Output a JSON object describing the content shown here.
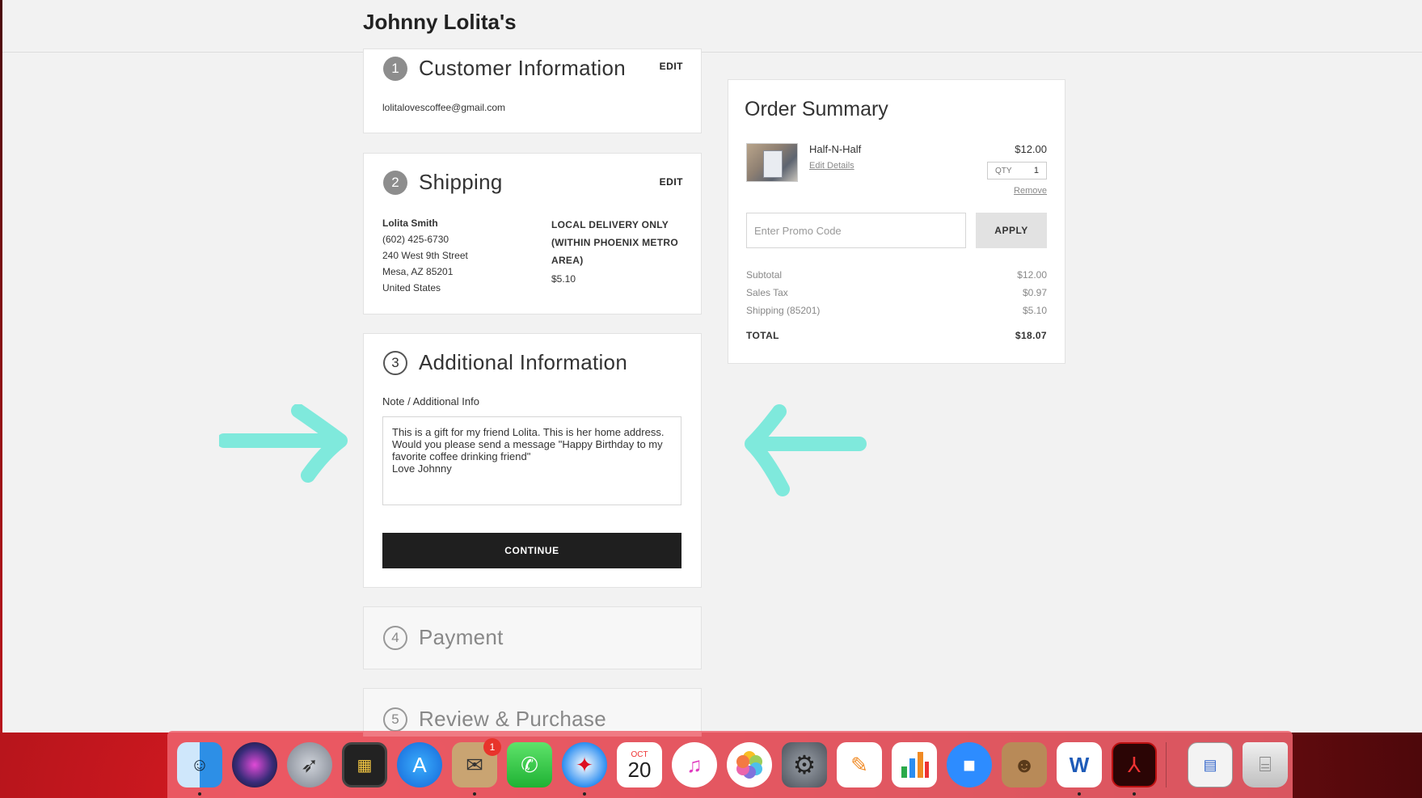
{
  "store": {
    "title": "Johnny Lolita's"
  },
  "customer": {
    "step": "1",
    "title": "Customer Information",
    "edit": "EDIT",
    "email": "lolitalovescoffee@gmail.com"
  },
  "shipping": {
    "step": "2",
    "title": "Shipping",
    "edit": "EDIT",
    "address": [
      "Lolita Smith",
      "(602) 425-6730",
      "240 West 9th Street",
      "Mesa, AZ 85201",
      "United States"
    ],
    "method": [
      "LOCAL DELIVERY ONLY",
      "(WITHIN PHOENIX METRO",
      "AREA)"
    ],
    "price": "$5.10"
  },
  "additional": {
    "step": "3",
    "title": "Additional Information",
    "note_label": "Note / Additional Info",
    "note_value": "This is a gift for my friend Lolita. This is her home address.  Would you please send a message \"Happy Birthday to my favorite coffee drinking friend\"\nLove Johnny",
    "continue": "CONTINUE"
  },
  "payment": {
    "step": "4",
    "title": "Payment"
  },
  "review": {
    "step": "5",
    "title": "Review & Purchase"
  },
  "summary": {
    "title": "Order Summary",
    "item": {
      "name": "Half-N-Half",
      "edit": "Edit Details",
      "price": "$12.00",
      "qty_label": "QTY",
      "qty": "1",
      "remove": "Remove"
    },
    "promo_placeholder": "Enter Promo Code",
    "apply": "APPLY",
    "subtotal_label": "Subtotal",
    "subtotal": "$12.00",
    "tax_label": "Sales Tax",
    "tax": "$0.97",
    "shipping_label": "Shipping (85201)",
    "shipping": "$5.10",
    "total_label": "TOTAL",
    "total": "$18.07"
  },
  "dock": {
    "apps": [
      "finder-icon",
      "siri-icon",
      "launchpad-icon",
      "photo-booth-icon",
      "app-store-icon",
      "mail-icon",
      "facetime-icon",
      "safari-icon",
      "calendar-icon",
      "itunes-icon",
      "photos-icon",
      "system-preferences-icon",
      "pages-icon",
      "numbers-icon",
      "zoom-icon",
      "contacts-icon",
      "word-icon",
      "acrobat-icon",
      "preview-icon",
      "trash-icon"
    ],
    "mail_badge": "1",
    "calendar_month": "OCT",
    "calendar_day": "20"
  },
  "colors": {
    "arrow": "#7fe9dc",
    "button": "#1f1f1f"
  }
}
